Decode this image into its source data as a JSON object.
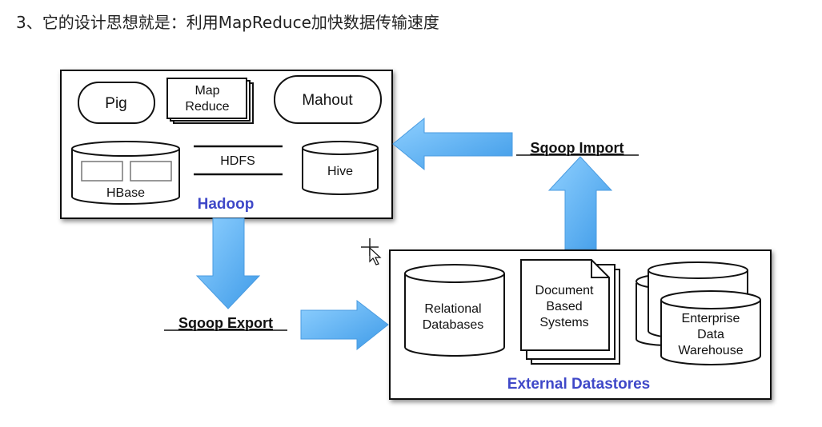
{
  "title": "3、它的设计思想就是：利用MapReduce加快数据传输速度",
  "hadoop": {
    "label": "Hadoop",
    "components": {
      "pig": "Pig",
      "map": "Map",
      "reduce": "Reduce",
      "mahout": "Mahout",
      "hbase": "HBase",
      "hdfs": "HDFS",
      "hive": "Hive"
    }
  },
  "external": {
    "label": "External Datastores",
    "relational": [
      "Relational",
      "Databases"
    ],
    "document": [
      "Document",
      "Based",
      "Systems"
    ],
    "warehouse": [
      "Enterprise",
      "Data",
      "Warehouse"
    ]
  },
  "arrows": {
    "import": "Sqoop Import",
    "export": "Sqoop Export"
  },
  "colors": {
    "accent": "#3f48c8",
    "arrow": "#5aaef0"
  }
}
